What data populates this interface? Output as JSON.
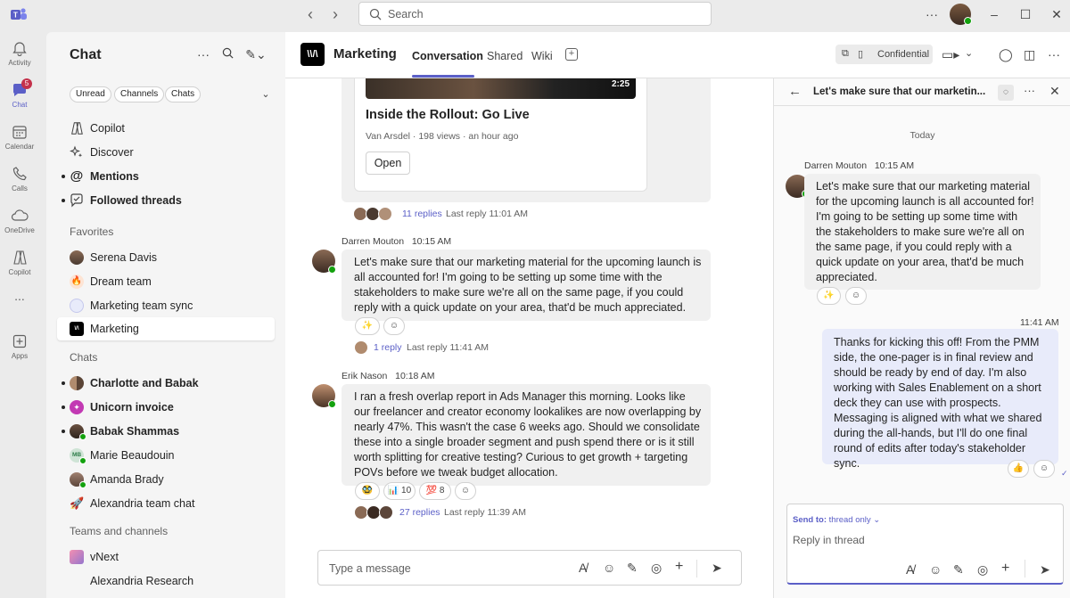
{
  "titlebar": {
    "search_placeholder": "Search"
  },
  "rail": [
    {
      "label": "Activity",
      "icon": "bell-icon"
    },
    {
      "label": "Chat",
      "icon": "chat-icon",
      "badge": "5",
      "active": true
    },
    {
      "label": "Calendar",
      "icon": "calendar-icon"
    },
    {
      "label": "Calls",
      "icon": "phone-icon"
    },
    {
      "label": "OneDrive",
      "icon": "cloud-icon"
    },
    {
      "label": "Copilot",
      "icon": "copilot-icon"
    },
    {
      "label": "...",
      "icon": "more-icon"
    },
    {
      "label": "Apps",
      "icon": "apps-icon"
    }
  ],
  "left": {
    "title": "Chat",
    "filters": [
      "Unread",
      "Channels",
      "Chats"
    ],
    "top_items": [
      {
        "label": "Copilot",
        "icon": "copilot-icon"
      },
      {
        "label": "Discover",
        "icon": "sparkle-icon"
      },
      {
        "label": "Mentions",
        "icon": "at-icon",
        "bold": true
      },
      {
        "label": "Followed threads",
        "icon": "followed-icon",
        "bold": true
      }
    ],
    "favorites_header": "Favorites",
    "favorites": [
      {
        "label": "Serena Davis"
      },
      {
        "label": "Dream team"
      },
      {
        "label": "Marketing team sync"
      },
      {
        "label": "Marketing",
        "selected": true
      }
    ],
    "chats_header": "Chats",
    "chats": [
      {
        "label": "Charlotte and Babak",
        "bold": true
      },
      {
        "label": "Unicorn invoice",
        "bold": true
      },
      {
        "label": "Babak Shammas",
        "bold": true
      },
      {
        "label": "Marie Beaudouin",
        "initials": "MB"
      },
      {
        "label": "Amanda Brady"
      },
      {
        "label": "Alexandria team chat"
      }
    ],
    "teams_header": "Teams and channels",
    "teams": [
      {
        "label": "vNext"
      },
      {
        "label": "Alexandria Research"
      }
    ]
  },
  "channel": {
    "logo": "\\\\/\\",
    "title": "Marketing",
    "tabs": [
      "Conversation",
      "Shared",
      "Wiki"
    ],
    "confidential": "Confidential"
  },
  "card": {
    "duration": "2:25",
    "title": "Inside the Rollout: Go Live",
    "meta": "Van Arsdel · 198 views · an hour ago",
    "open_label": "Open"
  },
  "card_replies": {
    "count": "11 replies",
    "last": "Last reply 11:01 AM"
  },
  "messages": [
    {
      "author": "Darren Mouton",
      "time": "10:15 AM",
      "text": "Let's make sure that our marketing material for the upcoming launch is all accounted for! I'm going to be setting up some time with the stakeholders to make sure we're all on the same page, if you could reply with a quick update on your area, that'd be much appreciated.",
      "reactions": [
        "✨"
      ],
      "replies": "1 reply",
      "last": "Last reply 11:41 AM"
    },
    {
      "author": "Erik Nason",
      "time": "10:18 AM",
      "text": "I ran a fresh overlap report in Ads Manager this morning. Looks like our freelancer and creator economy lookalikes are now overlapping by nearly 47%. This wasn't the case 6 weeks ago. Should we consolidate these into a single broader segment and push spend there or is it still worth splitting for creative testing? Curious to get growth + targeting POVs before we tweak budget allocation.",
      "reactions": [
        "🥸",
        "📊 10",
        "💯 8"
      ],
      "replies": "27 replies",
      "last": "Last reply 11:39 AM"
    }
  ],
  "compose_placeholder": "Type a message",
  "thread": {
    "title": "Let's make sure that our marketin...",
    "today": "Today",
    "root_author": "Darren Mouton",
    "root_time": "10:15 AM",
    "root_text": "Let's make sure that our marketing material for the upcoming launch is all accounted for! I'm going to be setting up some time with the stakeholders to make sure we're all on the same page, if you could reply with a quick update on your area, that'd be much appreciated.",
    "reply_time": "11:41 AM",
    "reply_text": "Thanks for kicking this off! From the PMM side, the one-pager is in final review and should be ready by end of day. I'm also working with Sales Enablement on a short deck they can use with prospects. Messaging is aligned with what we shared during the all-hands, but I'll do one final round of edits after today's stakeholder sync.",
    "send_to_label": "Send to:",
    "send_to_value": "thread only",
    "reply_placeholder": "Reply in thread"
  }
}
